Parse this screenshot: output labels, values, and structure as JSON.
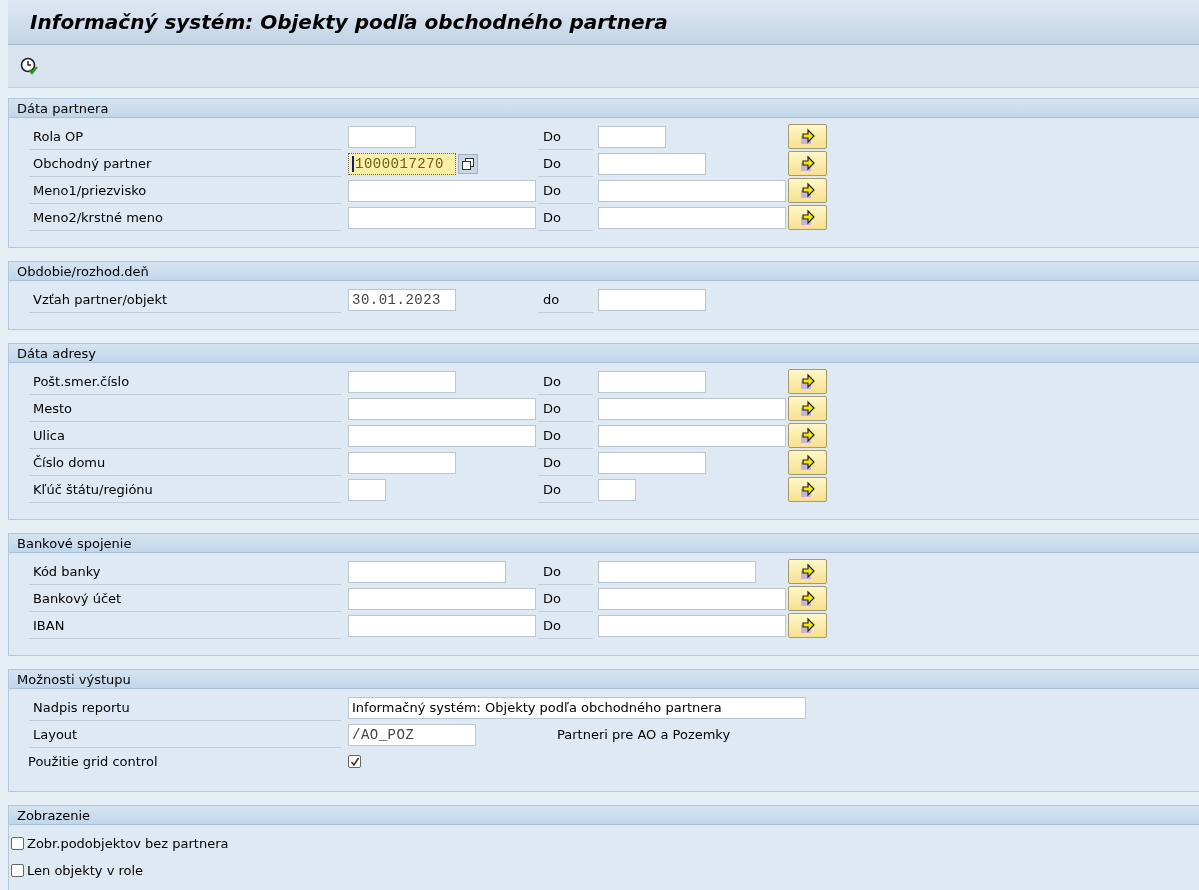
{
  "window": {
    "title": "Informačný systém: Objekty podľa obchodného partnera"
  },
  "sections": [
    {
      "title": "Dáta partnera",
      "rows": [
        {
          "kind": "range",
          "label": "Rola OP",
          "from": {
            "kind": "short"
          },
          "to_label": "Do",
          "to": {
            "kind": "short"
          },
          "multiple_selection": true
        },
        {
          "kind": "range",
          "label": "Obchodný partner",
          "from": {
            "kind": "medium",
            "value": "1000017270",
            "focused": true,
            "value_help": true
          },
          "to_label": "Do",
          "to": {
            "kind": "medium"
          },
          "multiple_selection": true
        },
        {
          "kind": "range",
          "label": "Meno1/priezvisko",
          "from": {
            "kind": "long"
          },
          "to_label": "Do",
          "to": {
            "kind": "long"
          },
          "multiple_selection": true
        },
        {
          "kind": "range",
          "label": "Meno2/krstné meno",
          "from": {
            "kind": "long"
          },
          "to_label": "Do",
          "to": {
            "kind": "long"
          },
          "multiple_selection": true
        }
      ]
    },
    {
      "title": "Obdobie/rozhod.deň",
      "rows": [
        {
          "kind": "range",
          "label": "Vzťah partner/objekt",
          "from": {
            "kind": "medium",
            "value": "30.01.2023"
          },
          "to_label": "do",
          "to": {
            "kind": "medium"
          },
          "multiple_selection": false
        }
      ]
    },
    {
      "title": "Dáta adresy",
      "rows": [
        {
          "kind": "range",
          "label": "Pošt.smer.číslo",
          "from": {
            "kind": "medium"
          },
          "to_label": "Do",
          "to": {
            "kind": "medium"
          },
          "multiple_selection": true
        },
        {
          "kind": "range",
          "label": "Mesto",
          "from": {
            "kind": "long"
          },
          "to_label": "Do",
          "to": {
            "kind": "long"
          },
          "multiple_selection": true
        },
        {
          "kind": "range",
          "label": "Ulica",
          "from": {
            "kind": "long"
          },
          "to_label": "Do",
          "to": {
            "kind": "long"
          },
          "multiple_selection": true
        },
        {
          "kind": "range",
          "label": "Číslo domu",
          "from": {
            "kind": "medium"
          },
          "to_label": "Do",
          "to": {
            "kind": "medium"
          },
          "multiple_selection": true
        },
        {
          "kind": "range",
          "label": "Kľúč štátu/regiónu",
          "from": {
            "kind": "tiny"
          },
          "to_label": "Do",
          "to": {
            "kind": "tiny"
          },
          "multiple_selection": true
        }
      ]
    },
    {
      "title": "Bankové spojenie",
      "rows": [
        {
          "kind": "range",
          "label": "Kód banky",
          "from": {
            "kind": "bank"
          },
          "to_label": "Do",
          "to": {
            "kind": "bank"
          },
          "multiple_selection": true
        },
        {
          "kind": "range",
          "label": "Bankový účet",
          "from": {
            "kind": "long"
          },
          "to_label": "Do",
          "to": {
            "kind": "long"
          },
          "multiple_selection": true
        },
        {
          "kind": "range",
          "label": "IBAN",
          "from": {
            "kind": "long"
          },
          "to_label": "Do",
          "to": {
            "kind": "long"
          },
          "multiple_selection": true
        }
      ]
    },
    {
      "title": "Možnosti výstupu",
      "rows": [
        {
          "kind": "text",
          "label": "Nadpis reportu",
          "value": "Informačný systém: Objekty podľa obchodného partnera"
        },
        {
          "kind": "layout",
          "label": "Layout",
          "value": "/AO_POZ",
          "description": "Partneri pre AO a Pozemky"
        },
        {
          "kind": "checkbox",
          "label": "Použitie grid control",
          "checked": true
        }
      ]
    },
    {
      "title": "Zobrazenie",
      "rows": [
        {
          "kind": "option",
          "label": "Zobr.podobjektov bez partnera",
          "checked": false
        },
        {
          "kind": "option",
          "label": "Len objekty v role",
          "checked": false
        }
      ]
    }
  ]
}
